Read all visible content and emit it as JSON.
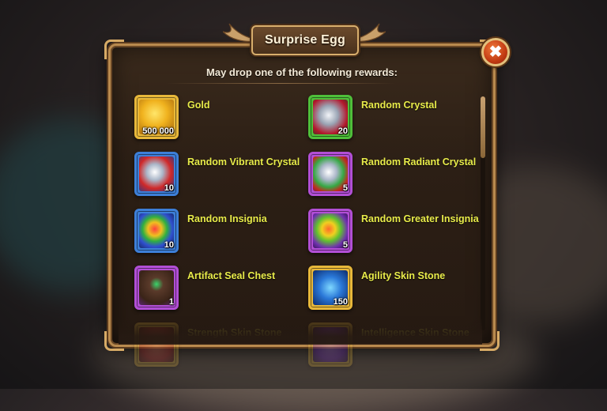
{
  "dialog": {
    "title": "Surprise Egg",
    "close_label": "✖",
    "subtitle": "May drop one of the following rewards:"
  },
  "rewards": [
    {
      "name": "Gold",
      "qty": "500 000",
      "rarity": "gold",
      "icon": "gold-coin-icon"
    },
    {
      "name": "Random Crystal",
      "qty": "20",
      "rarity": "green",
      "icon": "crystal-icon"
    },
    {
      "name": "Random Vibrant Crystal",
      "qty": "10",
      "rarity": "blue",
      "icon": "vibrant-crystal-icon"
    },
    {
      "name": "Random Radiant Crystal",
      "qty": "5",
      "rarity": "purple",
      "icon": "radiant-crystal-icon"
    },
    {
      "name": "Random Insignia",
      "qty": "10",
      "rarity": "blue",
      "icon": "insignia-orb-icon"
    },
    {
      "name": "Random Greater Insignia",
      "qty": "5",
      "rarity": "purple",
      "icon": "greater-insignia-orb-icon"
    },
    {
      "name": "Artifact Seal Chest",
      "qty": "1",
      "rarity": "purple",
      "icon": "seal-chest-icon"
    },
    {
      "name": "Agility Skin Stone",
      "qty": "150",
      "rarity": "gold",
      "icon": "agility-skin-stone-icon"
    },
    {
      "name": "Strength Skin Stone",
      "qty": "",
      "rarity": "gold",
      "icon": "strength-skin-stone-icon"
    },
    {
      "name": "Intelligence Skin Stone",
      "qty": "",
      "rarity": "gold",
      "icon": "intelligence-skin-stone-icon"
    }
  ],
  "colors": {
    "gold": "#e8b83a",
    "green": "#4fbf3a",
    "blue": "#3d7fd8",
    "purple": "#b24fd6",
    "label": "#e9ec4a"
  }
}
